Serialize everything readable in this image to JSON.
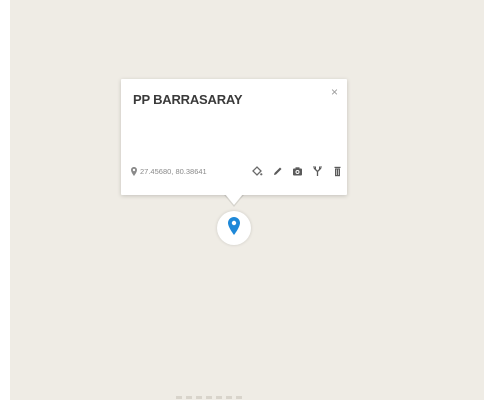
{
  "popup": {
    "title": "PP BARRASARAY",
    "close_label": "×",
    "coordinates": "27.45680, 80.38641",
    "tools": [
      {
        "name": "paint-bucket-icon"
      },
      {
        "name": "pencil-icon"
      },
      {
        "name": "camera-icon"
      },
      {
        "name": "route-fork-icon"
      },
      {
        "name": "trash-icon"
      }
    ]
  },
  "colors": {
    "map_background": "#efece5",
    "marker_blue": "#1e88d8",
    "text_dark": "#3a3a3a",
    "text_muted": "#8a8a8a"
  }
}
